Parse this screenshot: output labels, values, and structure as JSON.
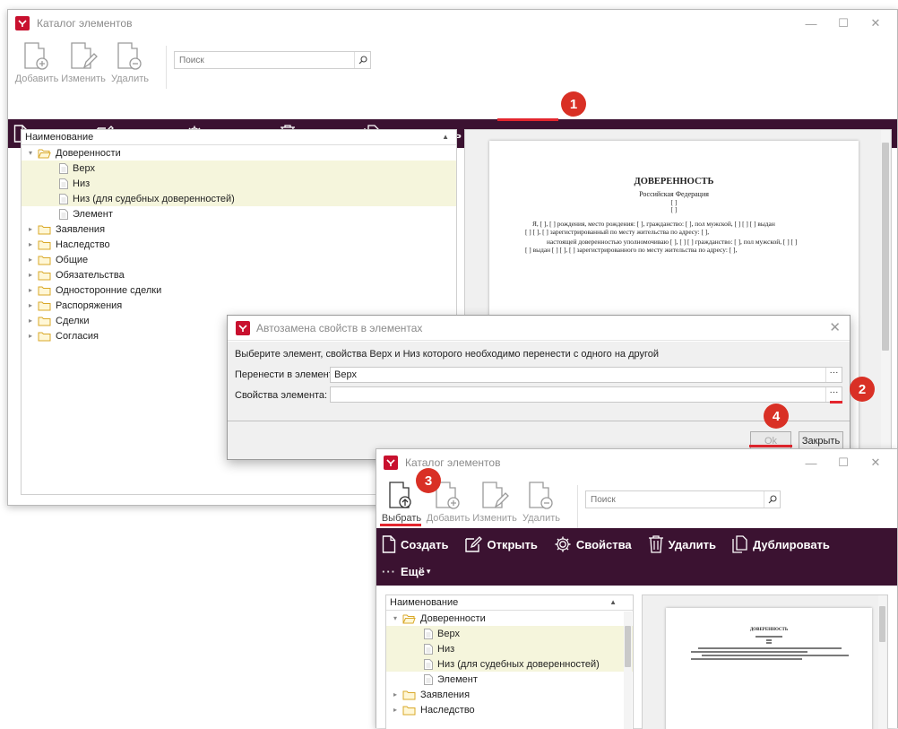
{
  "app": {
    "title": "Каталог элементов",
    "brand_color": "#c8102e",
    "toolbar_bg": "#3b1231",
    "highlight_color": "#e4262e"
  },
  "ribbon": {
    "add": "Добавить",
    "edit": "Изменить",
    "delete": "Удалить",
    "select": "Выбрать",
    "search_placeholder": "Поиск"
  },
  "toolbar": {
    "create": "Создать",
    "open": "Открыть",
    "properties": "Свойства",
    "delete": "Удалить",
    "duplicate": "Дублировать",
    "more": "Ещё",
    "more_dots": "···",
    "more_caret": "▾"
  },
  "tree": {
    "header": "Наименование",
    "items": [
      {
        "label": "Доверенности",
        "level": 0,
        "type": "folder",
        "expanded": true
      },
      {
        "label": "Верх",
        "level": 1,
        "type": "doc",
        "highlighted": true
      },
      {
        "label": "Низ",
        "level": 1,
        "type": "doc",
        "highlighted": true
      },
      {
        "label": "Низ (для судебных доверенностей)",
        "level": 1,
        "type": "doc",
        "highlighted": true
      },
      {
        "label": "Элемент",
        "level": 1,
        "type": "doc",
        "highlighted": false
      },
      {
        "label": "Заявления",
        "level": 0,
        "type": "folder"
      },
      {
        "label": "Наследство",
        "level": 0,
        "type": "folder"
      },
      {
        "label": "Общие",
        "level": 0,
        "type": "folder"
      },
      {
        "label": "Обязательства",
        "level": 0,
        "type": "folder"
      },
      {
        "label": "Односторонние сделки",
        "level": 0,
        "type": "folder"
      },
      {
        "label": "Распоряжения",
        "level": 0,
        "type": "folder"
      },
      {
        "label": "Сделки",
        "level": 0,
        "type": "folder"
      },
      {
        "label": "Согласия",
        "level": 0,
        "type": "folder"
      }
    ]
  },
  "document": {
    "title": "ДОВЕРЕННОСТЬ",
    "subtitle": "Российская Федерация",
    "bracket1": "[ ]",
    "bracket2": "[ ]",
    "para1_line1": "Я, [ ], [ ] рождения, место рождения: [ ], гражданство: [ ], пол мужской, [ ] [ ] [ ] выдан",
    "para1_line2": "[ ] [ ], [ ] зарегистрированный по месту жительства по адресу: [ ],",
    "para2_line1": "настоящей доверенностью уполномочиваю [ ], [ ] [ ] гражданство: [ ], пол мужской, [ ] [ ]",
    "para2_line2": "[ ] выдан [ ] [ ], [ ] зарегистрированного по месту жительства по адресу: [ ],",
    "mini_title": "ДОВЕРЕННОСТЬ"
  },
  "dialog": {
    "title": "Автозамена свойств в элементах",
    "instruction": "Выберите элемент, свойства Верх и Низ которого необходимо перенести с одного на другой",
    "move_label": "Перенести в элемент:",
    "move_value": "Верх",
    "props_label": "Свойства элемента:",
    "props_value": "",
    "ellipsis": "···",
    "ok": "Ok",
    "close": "Закрыть"
  },
  "badges": [
    "1",
    "2",
    "3",
    "4"
  ]
}
